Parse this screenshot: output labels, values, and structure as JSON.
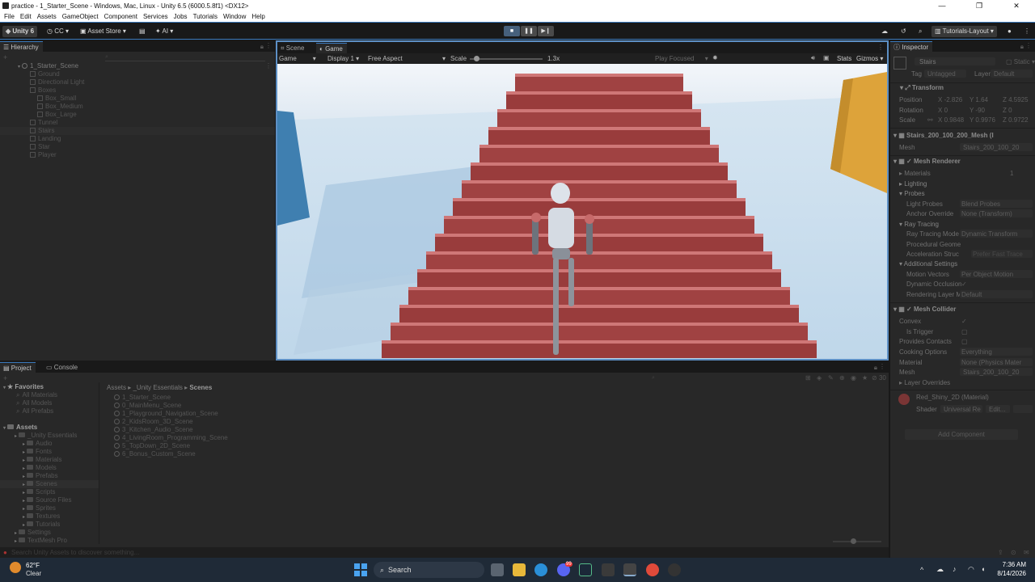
{
  "window": {
    "title": "practice - 1_Starter_Scene - Windows, Mac, Linux - Unity 6.5 (6000.5.8f1) <DX12>",
    "controls": [
      "—",
      "❐",
      "✕"
    ]
  },
  "menubar": [
    "File",
    "Edit",
    "Assets",
    "GameObject",
    "Component",
    "Services",
    "Jobs",
    "Tutorials",
    "Window",
    "Help"
  ],
  "toolbar": {
    "unity_label": "Unity 6",
    "cc_label": "CC",
    "asset_store_label": "Asset Store",
    "ai_label": "AI",
    "layout_label": "Tutorials-Layout"
  },
  "hierarchy": {
    "tab_label": "Hierarchy",
    "scene_name": "1_Starter_Scene",
    "items": [
      {
        "label": "Ground",
        "indent": 1
      },
      {
        "label": "Directional Light",
        "indent": 1
      },
      {
        "label": "Boxes",
        "indent": 1
      },
      {
        "label": "Box_Small",
        "indent": 2
      },
      {
        "label": "Box_Medium",
        "indent": 2
      },
      {
        "label": "Box_Large",
        "indent": 2
      },
      {
        "label": "Tunnel",
        "indent": 1
      },
      {
        "label": "Stairs",
        "indent": 1
      },
      {
        "label": "Landing",
        "indent": 1
      },
      {
        "label": "Star",
        "indent": 1
      },
      {
        "label": "Player",
        "indent": 1
      }
    ]
  },
  "viewtabs": {
    "scene": "Scene",
    "game": "Game",
    "game_dropdown": "Game",
    "display": "Display 1",
    "aspect": "Free Aspect",
    "scale_label": "Scale",
    "scale_value": 0.05,
    "scale_text": "1.3x",
    "play_focused": "Play Focused",
    "stats": "Stats",
    "gizmos": "Gizmos"
  },
  "inspector": {
    "tab_label": "Inspector",
    "object_name": "Stairs",
    "static_label": "Static",
    "tag_label": "Tag",
    "tag_value": "Untagged",
    "layer_label": "Layer",
    "layer_value": "Default",
    "transform": {
      "title": "Transform",
      "position_label": "Position",
      "rotation_label": "Rotation",
      "scale_label": "Scale",
      "position": {
        "x": "-2.826",
        "y": "1.64",
        "z": "4.5925"
      },
      "rotation": {
        "x": "0",
        "y": "-90",
        "z": "0"
      },
      "scale": {
        "x": "0.9848",
        "y": "0.9976",
        "z": "0.9722"
      }
    },
    "mesh_filter": {
      "title": "Stairs_200_100_200_Mesh (I",
      "mesh_label": "Mesh",
      "mesh_value": "Stairs_200_100_20"
    },
    "mesh_renderer": {
      "title": "Mesh Renderer",
      "materials_label": "Materials",
      "materials_count": "1",
      "lighting_label": "Lighting",
      "probes_label": "Probes",
      "light_probes_label": "Light Probes",
      "light_probes_value": "Blend Probes",
      "anchor_override_label": "Anchor Override",
      "anchor_override_value": "None (Transform)",
      "ray_tracing_label": "Ray Tracing",
      "ray_tracing_mode_label": "Ray Tracing Mode",
      "ray_tracing_mode_value": "Dynamic Transform",
      "procedural_label": "Procedural Geome",
      "accel_label": "Acceleration Struc",
      "accel_value": "Prefer Fast Trace",
      "additional_label": "Additional Settings",
      "motion_vectors_label": "Motion Vectors",
      "motion_vectors_value": "Per Object Motion",
      "dynamic_occlusion_label": "Dynamic Occlusion",
      "rendering_layer_label": "Rendering Layer M",
      "rendering_layer_value": "Default"
    },
    "mesh_collider": {
      "title": "Mesh Collider",
      "convex_label": "Convex",
      "is_trigger_label": "Is Trigger",
      "provides_contacts_label": "Provides Contacts",
      "cooking_label": "Cooking Options",
      "cooking_value": "Everything",
      "material_label": "Material",
      "material_value": "None (Physics Mater",
      "mesh_label": "Mesh",
      "mesh_value": "Stairs_200_100_20",
      "layer_overrides_label": "Layer Overrides"
    },
    "material": {
      "title": "Red_Shiny_2D (Material)",
      "shader_label": "Shader",
      "shader_value": "Universal Re",
      "edit_label": "Edit..."
    },
    "add_component": "Add Component"
  },
  "project": {
    "tab_label": "Project",
    "console_label": "Console",
    "favorites_label": "Favorites",
    "favorites": [
      "All Materials",
      "All Models",
      "All Prefabs"
    ],
    "assets_label": "Assets",
    "tree": [
      {
        "label": "_Unity Essentials",
        "indent": 1
      },
      {
        "label": "Audio",
        "indent": 2
      },
      {
        "label": "Fonts",
        "indent": 2
      },
      {
        "label": "Materials",
        "indent": 2
      },
      {
        "label": "Models",
        "indent": 2
      },
      {
        "label": "Prefabs",
        "indent": 2
      },
      {
        "label": "Scenes",
        "indent": 2
      },
      {
        "label": "Scripts",
        "indent": 2
      },
      {
        "label": "Source Files",
        "indent": 2
      },
      {
        "label": "Sprites",
        "indent": 2
      },
      {
        "label": "Textures",
        "indent": 2
      },
      {
        "label": "Tutorials",
        "indent": 2
      },
      {
        "label": "Settings",
        "indent": 1
      },
      {
        "label": "TextMesh Pro",
        "indent": 1
      }
    ],
    "breadcrumb": [
      "Assets",
      "_Unity Essentials",
      "Scenes"
    ],
    "files": [
      "1_Starter_Scene",
      "0_MainMenu_Scene",
      "1_Playground_Navigation_Scene",
      "2_KidsRoom_3D_Scene",
      "3_Kitchen_Audio_Scene",
      "4_LivingRoom_Programming_Scene",
      "5_TopDown_2D_Scene",
      "6_Bonus_Custom_Scene"
    ],
    "count": "30",
    "status_text": "Search Unity Assets to discover something..."
  },
  "taskbar": {
    "weather_temp": "62°F",
    "weather_desc": "Clear",
    "search_label": "Search",
    "time": "7:36 AM",
    "date": "8/14/2026",
    "chat_badge": "99"
  }
}
